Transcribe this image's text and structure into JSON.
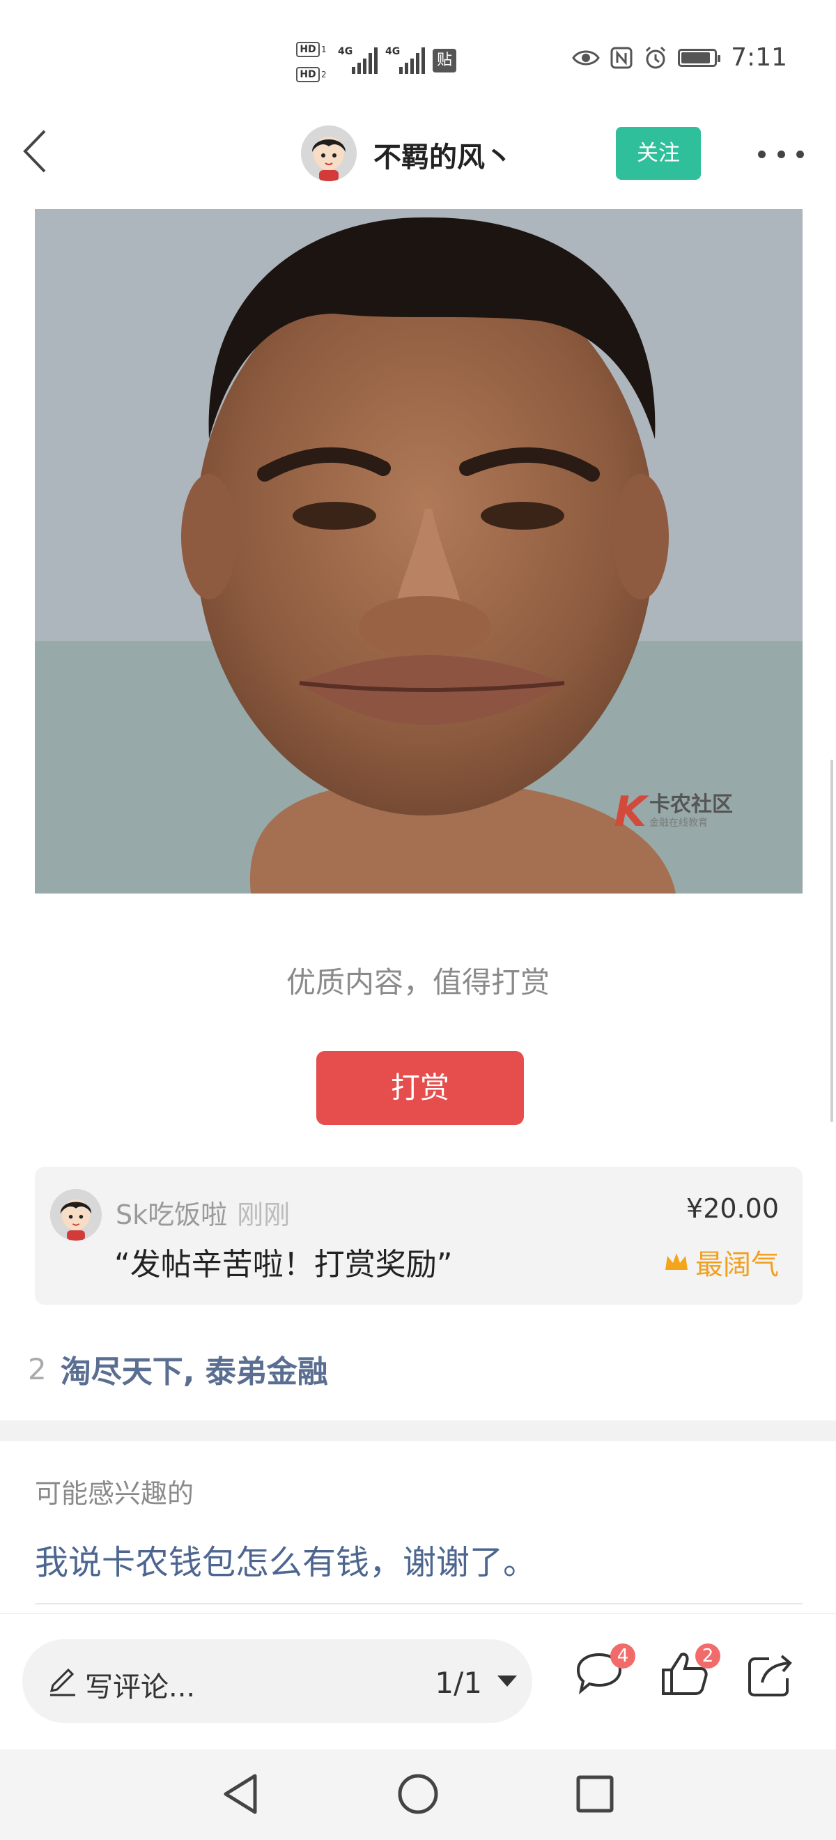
{
  "status_bar": {
    "hd1": "HD",
    "hd1_sub": "1",
    "hd2": "HD",
    "hd2_sub": "2",
    "network1": "4G",
    "network2": "4G",
    "app_badge": "贴",
    "battery_level": 0.9,
    "time": "7:11"
  },
  "header": {
    "author_name": "不羁的风丶",
    "follow_label": "关注"
  },
  "post": {
    "watermark_logo": "K",
    "watermark_text": "卡农社区",
    "watermark_subtext": "金融在线教育"
  },
  "reward": {
    "prompt": "优质内容，值得打赏",
    "button_label": "打赏"
  },
  "tip": {
    "user": "Sk吃饭啦",
    "time": "刚刚",
    "message": "“发帖辛苦啦！打赏奖励”",
    "amount": "¥20.00",
    "badge": "最阔气"
  },
  "signature": {
    "number": "2",
    "text": "淘尽天下, 泰弟金融"
  },
  "interest": {
    "title": "可能感兴趣的",
    "items": [
      "我说卡农钱包怎么有钱，谢谢了。"
    ]
  },
  "bottom_bar": {
    "comment_placeholder": "写评论...",
    "page_indicator": "1/1",
    "comment_count": "4",
    "like_count": "2"
  }
}
